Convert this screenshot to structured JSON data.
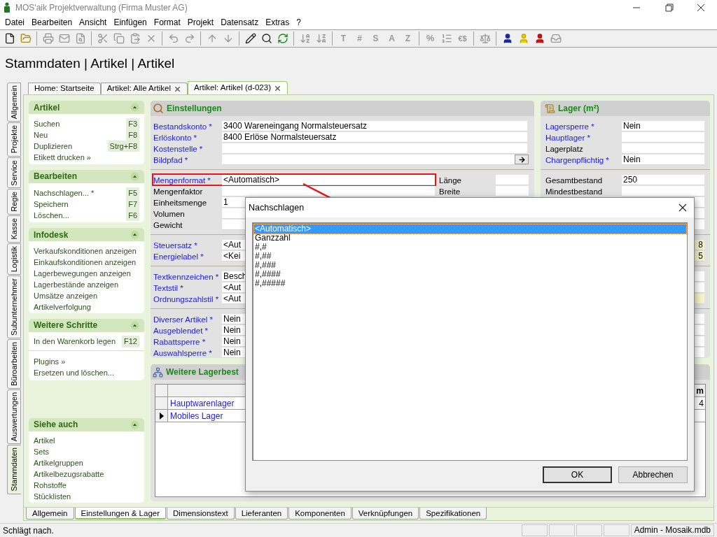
{
  "window": {
    "title": "MOS'aik Projektverwaltung (Firma Muster AG)"
  },
  "menu": [
    "Datei",
    "Bearbeiten",
    "Ansicht",
    "Einfügen",
    "Format",
    "Projekt",
    "Datensatz",
    "Extras",
    "?"
  ],
  "toolbar": {
    "format_glyphs": [
      "T",
      "#",
      "S",
      "A",
      "Z"
    ],
    "number_glyphs": [
      "%",
      "€$"
    ]
  },
  "page_title": "Stammdaten | Artikel | Artikel",
  "side_tabs": [
    {
      "label": "Allgemein",
      "selected": false
    },
    {
      "label": "Projekte",
      "selected": false
    },
    {
      "label": "Service",
      "selected": false
    },
    {
      "label": "Regie",
      "selected": false
    },
    {
      "label": "Kasse",
      "selected": false
    },
    {
      "label": "Logistik",
      "selected": false
    },
    {
      "label": "Subunternehmer",
      "selected": false
    },
    {
      "label": "Büroarbeiten",
      "selected": false
    },
    {
      "label": "Auswertungen",
      "selected": false
    },
    {
      "label": "Stammdaten",
      "selected": true
    }
  ],
  "doc_tabs": [
    {
      "label": "Home: Startseite",
      "closable": false,
      "selected": false
    },
    {
      "label": "Artikel: Alle Artikel",
      "closable": true,
      "selected": false
    },
    {
      "label": "Artikel: Artikel (d-023)",
      "closable": true,
      "selected": true
    }
  ],
  "task_panels": [
    {
      "title": "Artikel",
      "groups": [
        [
          {
            "label": "Suchen",
            "shortcut": "F3"
          },
          {
            "label": "Neu",
            "shortcut": "F8"
          },
          {
            "label": "Duplizieren",
            "shortcut": "Strg+F8"
          },
          {
            "label": "Etikett drucken »"
          }
        ]
      ]
    },
    {
      "title": "Bearbeiten",
      "groups": [
        [
          {
            "label": "Nachschlagen... *",
            "shortcut": "F5"
          },
          {
            "label": "Speichern",
            "shortcut": "F7"
          },
          {
            "label": "Löschen...",
            "shortcut": "F6"
          }
        ]
      ]
    },
    {
      "title": "Infodesk",
      "groups": [
        [
          {
            "label": "Verkaufskonditionen anzeigen"
          },
          {
            "label": "Einkaufskonditionen anzeigen"
          },
          {
            "label": "Lagerbewegungen anzeigen"
          },
          {
            "label": "Lagerbestände anzeigen"
          },
          {
            "label": "Umsätze anzeigen"
          },
          {
            "label": "Artikelverfolgung"
          }
        ]
      ]
    },
    {
      "title": "Weitere Schritte",
      "groups": [
        [
          {
            "label": "In den Warenkorb legen",
            "shortcut": "F12"
          }
        ],
        [
          {
            "label": "Plugins »"
          },
          {
            "label": "Ersetzen und löschen..."
          }
        ]
      ]
    },
    {
      "title": "Siehe auch",
      "groups": [
        [
          {
            "label": "Artikel"
          },
          {
            "label": "Sets"
          },
          {
            "label": "Artikelgruppen"
          },
          {
            "label": "Artikelbezugsrabatte"
          },
          {
            "label": "Rohstoffe"
          },
          {
            "label": "Stücklisten"
          }
        ]
      ]
    }
  ],
  "settings": {
    "title": "Einstellungen",
    "groups": [
      [
        {
          "label": "Bestandskonto *",
          "required": true,
          "value": "3400 Wareneingang Normalsteuersatz"
        },
        {
          "label": "Erlöskonto *",
          "required": true,
          "value": "8400 Erlöse Normalsteuersatz"
        },
        {
          "label": "Kostenstelle *",
          "required": true
        },
        {
          "label": "Bildpfad *",
          "required": true,
          "browse": true
        }
      ],
      [
        {
          "label": "Mengenformat *",
          "required": true,
          "value": "<Automatisch>",
          "highlighted": true,
          "side_label": "Länge"
        },
        {
          "label": "Mengenfaktor",
          "required": false,
          "highlighted": false,
          "side_label": "Breite"
        },
        {
          "label": "Einheitsmenge",
          "required": false,
          "value": "1",
          "highlighted": false
        },
        {
          "label": "Volumen",
          "required": false,
          "highlighted": false
        },
        {
          "label": "Gewicht",
          "required": false,
          "highlighted": false
        }
      ],
      [
        {
          "label": "Steuersatz *",
          "required": true,
          "value": "<Aut"
        },
        {
          "label": "Energielabel *",
          "required": true,
          "value": "<Kei"
        }
      ],
      [
        {
          "label": "Textkennzeichen *",
          "required": true,
          "value": "Besch"
        },
        {
          "label": "Textstil *",
          "required": true,
          "value": "<Aut"
        },
        {
          "label": "Ordnungszahlstil *",
          "required": true,
          "value": "<Aut"
        }
      ],
      [
        {
          "label": "Diverser Artikel *",
          "required": true,
          "value": "Nein"
        },
        {
          "label": "Ausgeblendet *",
          "required": true,
          "value": "Nein"
        },
        {
          "label": "Rabattsperre *",
          "required": true,
          "value": "Nein"
        },
        {
          "label": "Auswahlsperre *",
          "required": true,
          "value": "Nein"
        }
      ]
    ]
  },
  "storage": {
    "title": "Lager (m²)",
    "groups": [
      [
        {
          "label": "Lagersperre *",
          "required": true,
          "value": "Nein",
          "highlight": false
        },
        {
          "label": "Hauptlager *",
          "required": true,
          "highlight": false
        },
        {
          "label": "Lagerplatz",
          "required": false,
          "highlight": false
        },
        {
          "label": "Chargenpflichtig *",
          "required": true,
          "value": "Nein",
          "highlight": false
        }
      ],
      [
        {
          "label": "Gesamtbestand",
          "required": false,
          "value": "250",
          "highlight": false
        },
        {
          "label": "Mindestbestand",
          "required": false,
          "highlight": false
        },
        {
          "highlight": false
        },
        {
          "highlight": false
        },
        {
          "highlight": false
        }
      ],
      [
        {
          "value": "8",
          "highlight": true
        },
        {
          "value": "5",
          "highlight": true
        }
      ],
      [
        {
          "highlight": false
        },
        {
          "highlight": false
        },
        {
          "highlight": true
        }
      ],
      [
        {
          "highlight": false
        },
        {
          "highlight": false
        },
        {
          "highlight": false
        },
        {
          "highlight": false
        }
      ]
    ]
  },
  "stock_grid": {
    "title": "Weitere Lagerbest",
    "columns": [
      "m"
    ],
    "rows": [
      {
        "name": "Hauptwarenlager",
        "column_2": "4",
        "current": false
      },
      {
        "name": "Mobiles Lager",
        "current": true
      }
    ]
  },
  "bottom_tabs": [
    {
      "label": "Allgemein",
      "selected": false
    },
    {
      "label": "Einstellungen & Lager",
      "selected": true
    },
    {
      "label": "Dimensionstext",
      "selected": false
    },
    {
      "label": "Lieferanten",
      "selected": false
    },
    {
      "label": "Komponenten",
      "selected": false
    },
    {
      "label": "Verknüpfungen",
      "selected": false
    },
    {
      "label": "Spezifikationen",
      "selected": false
    }
  ],
  "status_bar": {
    "message": "Schlägt nach.",
    "user": "Admin - Mosaik.mdb"
  },
  "dialog": {
    "title": "Nachschlagen",
    "items": [
      {
        "label": "<Automatisch>",
        "selected": true
      },
      {
        "label": "Ganzzahl",
        "selected": false
      },
      {
        "label": "#,#",
        "selected": false
      },
      {
        "label": "#,##",
        "selected": false
      },
      {
        "label": "#,###",
        "selected": false
      },
      {
        "label": "#,####",
        "selected": false
      },
      {
        "label": "#,#####",
        "selected": false
      }
    ],
    "buttons": [
      {
        "label": "OK",
        "default": true
      },
      {
        "label": "Abbrechen",
        "default": false
      }
    ]
  }
}
